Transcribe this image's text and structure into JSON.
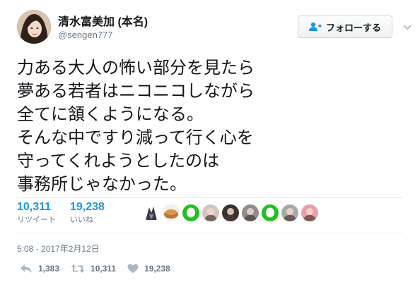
{
  "author": {
    "name": "清水富美加 (本名)",
    "handle": "@sengen777"
  },
  "follow_button": {
    "label": "フォローする"
  },
  "tweet_lines": [
    "力ある大人の怖い部分を見たら",
    "夢ある若者はニコニコしながら",
    "全てに頷くようになる。",
    "そんな中ですり減って行く心を",
    "守ってくれようとしたのは",
    "事務所じゃなかった。"
  ],
  "stats": {
    "retweets": {
      "count": "10,311",
      "label": "リツイート"
    },
    "likes": {
      "count": "19,238",
      "label": "いいね"
    }
  },
  "likers": [
    {
      "icon": "anime-character-avatar",
      "color": "#3b3b46"
    },
    {
      "icon": "food-avatar",
      "color": "#b7793a"
    },
    {
      "icon": "line-app-avatar",
      "color": "#1fc01f"
    },
    {
      "icon": "portrait-avatar",
      "color": "#d2c6bf"
    },
    {
      "icon": "dark-portrait-avatar",
      "color": "#3a3030"
    },
    {
      "icon": "grey-portrait-avatar",
      "color": "#8d8d8d"
    },
    {
      "icon": "line-app-avatar",
      "color": "#1fc01f"
    },
    {
      "icon": "portrait-avatar",
      "color": "#a8a8a8"
    },
    {
      "icon": "pink-portrait-avatar",
      "color": "#e7a0a8"
    }
  ],
  "timestamp": "5:08 - 2017年2月12日",
  "actions": {
    "reply_count": "1,383",
    "retweet_count": "10,311",
    "like_count": "19,238"
  },
  "colors": {
    "link_blue": "#1b95e0",
    "secondary_grey": "#657786",
    "action_grey": "#aab8c2"
  }
}
